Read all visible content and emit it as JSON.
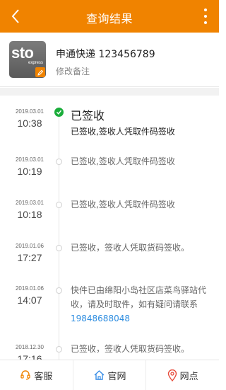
{
  "header": {
    "title": "查询结果"
  },
  "courier": {
    "logo_text": "sto",
    "logo_sub": "express",
    "name": "申通快递 123456789",
    "remark": "修改备注"
  },
  "timeline": [
    {
      "date": "2019.03.01",
      "time": "10:38",
      "status": "已签收",
      "detail": "已签收,签收人凭取件码签收",
      "latest": true
    },
    {
      "date": "2019.03.01",
      "time": "10:19",
      "detail": "已签收,签收人凭取件码签收"
    },
    {
      "date": "2019.03.01",
      "time": "10:18",
      "detail": "已签收,签收人凭取件码签收"
    },
    {
      "date": "2019.01.06",
      "time": "17:27",
      "detail": "已签收，签收人凭取货码签收。"
    },
    {
      "date": "2019.01.06",
      "time": "14:07",
      "detail_line1": "快件已由绵阳小岛社区店菜鸟驿站代",
      "detail_line2": "收，请及时取件，如有疑问请联系",
      "phone": "19848688048"
    },
    {
      "date": "2018.12.30",
      "time": "17:16",
      "detail": "已签收，签收人凭取货码签收。"
    }
  ],
  "bottom_bar": {
    "service": "客服",
    "website": "官网",
    "outlets": "网点"
  },
  "colors": {
    "brand": "#f08300",
    "done": "#1aad3a",
    "link": "#2e8de0"
  }
}
